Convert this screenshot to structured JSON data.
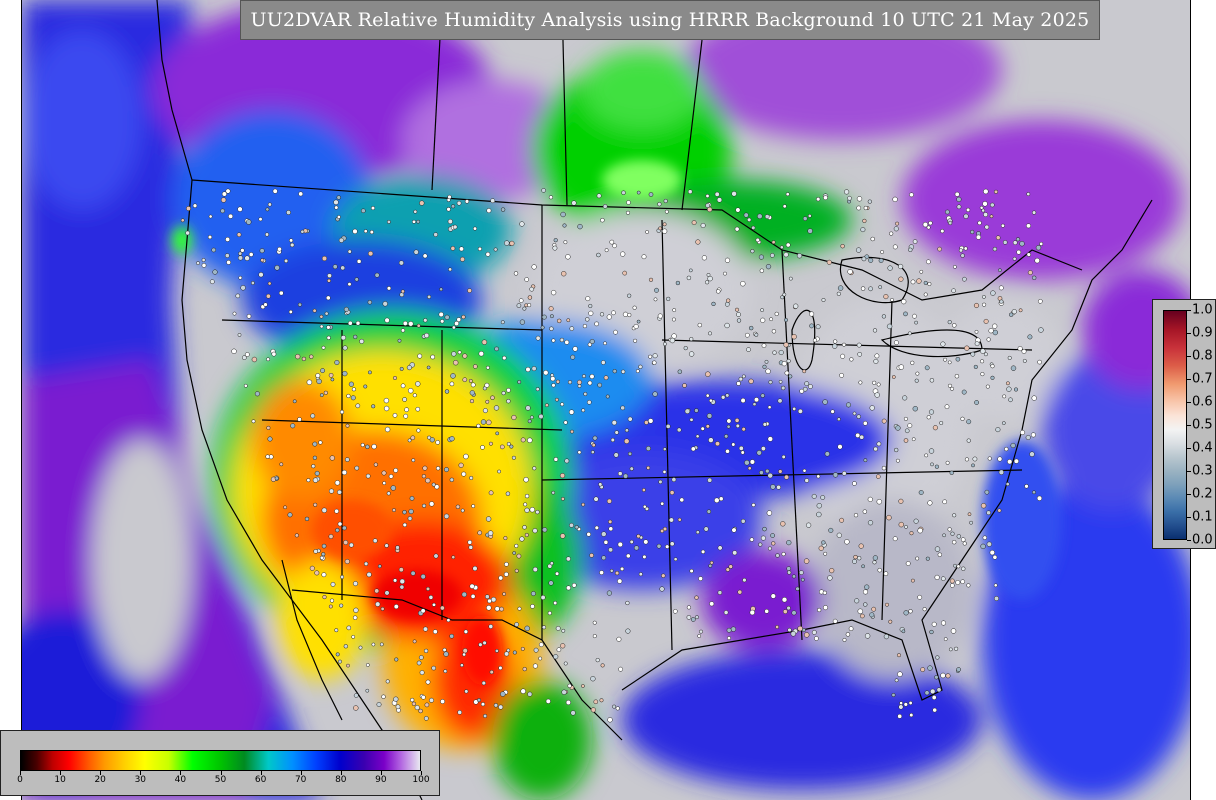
{
  "title": "UU2DVAR Relative Humidity Analysis using HRRR Background 10 UTC 21 May 2025",
  "colors": {
    "ocean_background": "#c9c9cf",
    "title_box": "#8a8a8a",
    "legend_panel": "#bdbdbd",
    "borders": "#000000"
  },
  "map_layers": {
    "field": "relative-humidity",
    "dry_region": "Desert Southwest (red/yellow)",
    "moist_region": "Oceans and Great Lakes (blue/purple)",
    "station_markers": "white-circle-markers"
  },
  "legend_bottom": {
    "ticks": [
      "0",
      "10",
      "20",
      "30",
      "40",
      "50",
      "60",
      "70",
      "80",
      "90",
      "100"
    ]
  },
  "legend_right": {
    "ticks": [
      "1.0",
      "0.9",
      "0.8",
      "0.7",
      "0.6",
      "0.5",
      "0.4",
      "0.3",
      "0.2",
      "0.1",
      "0.0"
    ]
  }
}
